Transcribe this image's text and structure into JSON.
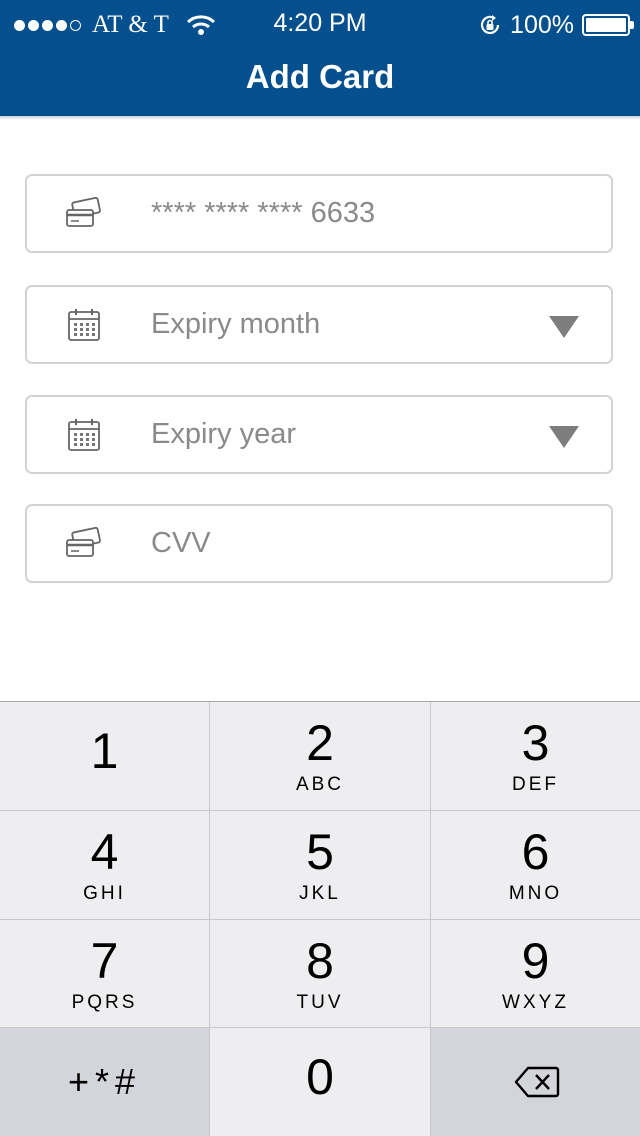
{
  "status_bar": {
    "carrier": "AT & T",
    "time": "4:20 PM",
    "battery": "100%",
    "signal_dots_filled": 4,
    "signal_dots_total": 5,
    "icons": [
      "signal-dots-icon",
      "wifi-icon",
      "rotation-lock-icon",
      "battery-icon"
    ]
  },
  "header": {
    "title": "Add Card",
    "color": "#04508f"
  },
  "form": {
    "card_number": {
      "value": "**** **** **** 6633",
      "icon": "credit-card-icon"
    },
    "expiry_month": {
      "placeholder": "Expiry month",
      "icon": "calendar-icon"
    },
    "expiry_year": {
      "placeholder": "Expiry year",
      "icon": "calendar-icon"
    },
    "cvv": {
      "placeholder": "CVV",
      "icon": "credit-card-icon"
    }
  },
  "keypad": {
    "keys": [
      {
        "num": "1",
        "letters": ""
      },
      {
        "num": "2",
        "letters": "ABC"
      },
      {
        "num": "3",
        "letters": "DEF"
      },
      {
        "num": "4",
        "letters": "GHI"
      },
      {
        "num": "5",
        "letters": "JKL"
      },
      {
        "num": "6",
        "letters": "MNO"
      },
      {
        "num": "7",
        "letters": "PQRS"
      },
      {
        "num": "8",
        "letters": "TUV"
      },
      {
        "num": "9",
        "letters": "WXYZ"
      }
    ],
    "symbols": "+*#",
    "zero": "0",
    "backspace_icon": "backspace-icon"
  }
}
